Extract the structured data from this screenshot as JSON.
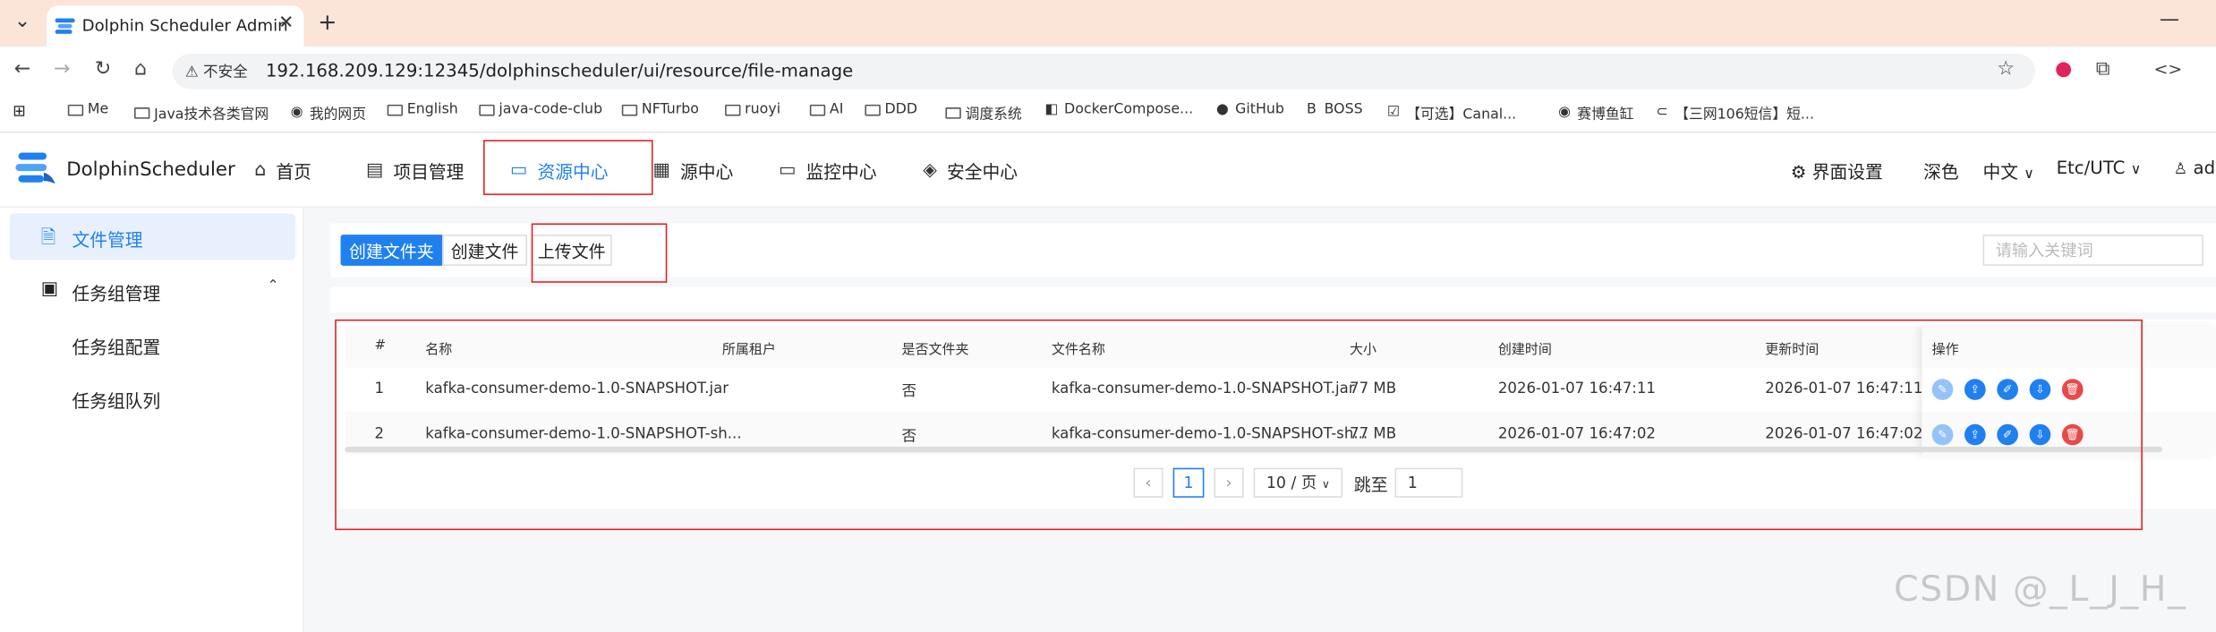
{
  "browser": {
    "tab_title": "Dolphin Scheduler Admin",
    "not_secure_label": "不安全",
    "url": "192.168.209.129:12345/dolphinscheduler/ui/resource/file-manage",
    "bookmarks": [
      {
        "icon": "folder-icon",
        "label": "Me"
      },
      {
        "icon": "folder-icon",
        "label": "Java技术各类官网"
      },
      {
        "icon": "globe-icon",
        "label": "我的网页"
      },
      {
        "icon": "folder-icon",
        "label": "English"
      },
      {
        "icon": "folder-icon",
        "label": "java-code-club"
      },
      {
        "icon": "folder-icon",
        "label": "NFTurbo"
      },
      {
        "icon": "folder-icon",
        "label": "ruoyi"
      },
      {
        "icon": "folder-icon",
        "label": "AI"
      },
      {
        "icon": "folder-icon",
        "label": "DDD"
      },
      {
        "icon": "folder-icon",
        "label": "调度系统"
      },
      {
        "icon": "docker-icon",
        "label": "DockerCompose..."
      },
      {
        "icon": "github-icon",
        "label": "GitHub"
      },
      {
        "icon": "boss-icon",
        "label": "BOSS"
      },
      {
        "icon": "checkbox-icon",
        "label": "【可选】Canal..."
      },
      {
        "icon": "globe-icon",
        "label": "赛博鱼缸"
      },
      {
        "icon": "link-icon",
        "label": "【三网106短信】短..."
      }
    ]
  },
  "app": {
    "brand": "DolphinScheduler",
    "menu": [
      {
        "icon": "home-icon",
        "label": "首页"
      },
      {
        "icon": "project-icon",
        "label": "项目管理"
      },
      {
        "icon": "folder-icon",
        "label": "资源中心"
      },
      {
        "icon": "datasource-icon",
        "label": "源中心"
      },
      {
        "icon": "monitor-icon",
        "label": "监控中心"
      },
      {
        "icon": "shield-icon",
        "label": "安全中心"
      }
    ],
    "right": {
      "settings_label": "界面设置",
      "theme_label": "深色",
      "lang_label": "中文",
      "timezone_label": "Etc/UTC",
      "user_label": "ad"
    }
  },
  "sidebar": {
    "items": [
      {
        "label": "文件管理"
      },
      {
        "label": "任务组管理"
      },
      {
        "label": "任务组配置"
      },
      {
        "label": "任务组队列"
      }
    ]
  },
  "toolbar": {
    "create_folder_label": "创建文件夹",
    "create_file_label": "创建文件",
    "upload_file_label": "上传文件",
    "search_placeholder": "请输入关键词"
  },
  "table": {
    "columns": [
      "#",
      "名称",
      "所属租户",
      "是否文件夹",
      "文件名称",
      "大小",
      "创建时间",
      "更新时间",
      "操作"
    ],
    "rows": [
      {
        "index": "1",
        "name": "kafka-consumer-demo-1.0-SNAPSHOT.jar",
        "tenant": "",
        "is_folder": "否",
        "file_name": "kafka-consumer-demo-1.0-SNAPSHOT.jar",
        "size": "77 MB",
        "created": "2026-01-07 16:47:11",
        "updated": "2026-01-07 16:47:11"
      },
      {
        "index": "2",
        "name": "kafka-consumer-demo-1.0-SNAPSHOT-sh...",
        "tenant": "",
        "is_folder": "否",
        "file_name": "kafka-consumer-demo-1.0-SNAPSHOT-sh...",
        "size": "77 MB",
        "created": "2026-01-07 16:47:02",
        "updated": "2026-01-07 16:47:02"
      }
    ]
  },
  "pagination": {
    "current_page": "1",
    "page_size_label": "10 / 页",
    "jump_label": "跳至",
    "jump_value": "1"
  },
  "watermark": "CSDN @_L_J_H_",
  "colors": {
    "primary": "#2080f0",
    "annotation_red": "#e02020",
    "danger": "#e84a4a"
  }
}
